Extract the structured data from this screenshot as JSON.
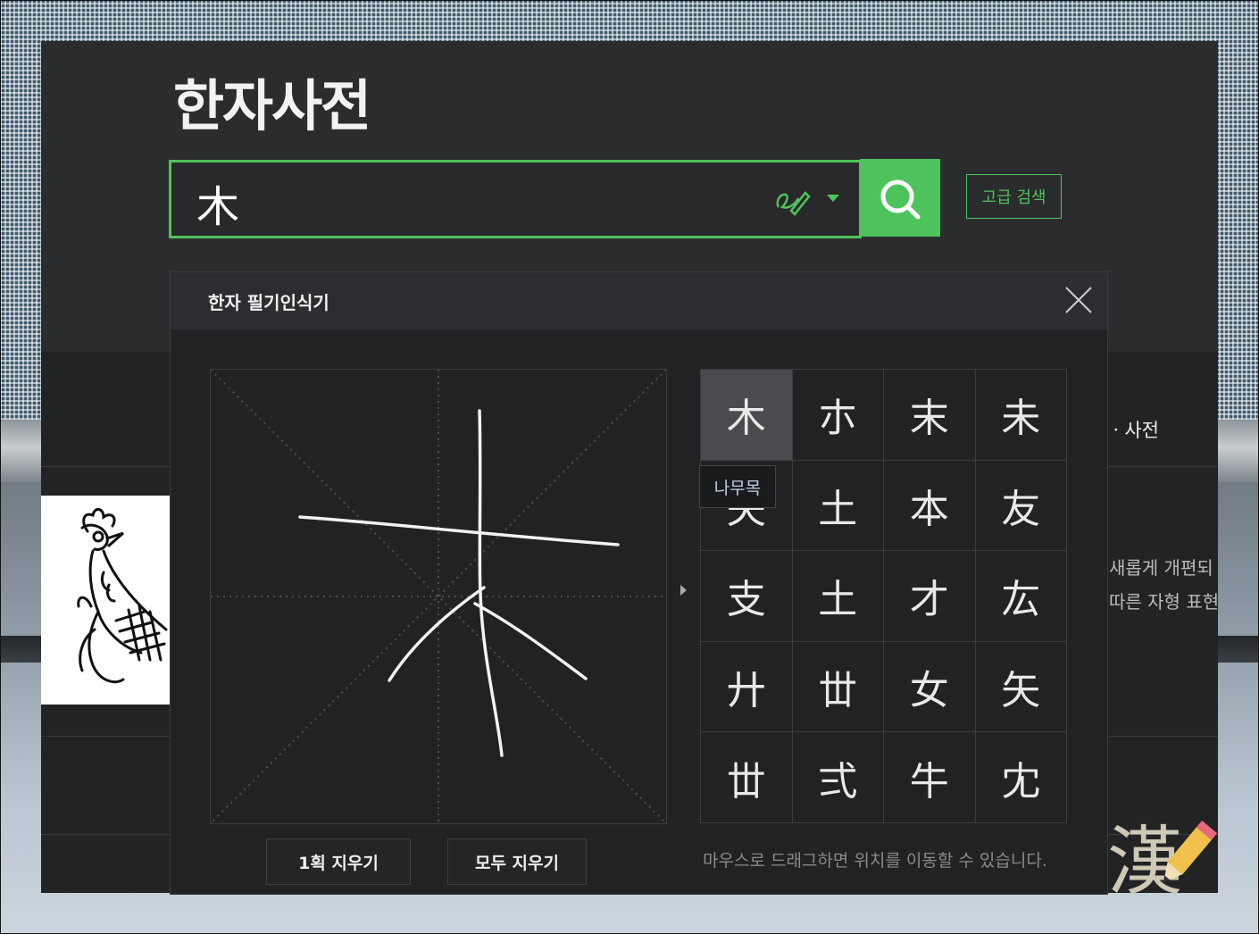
{
  "page": {
    "title": "한자사전",
    "search": {
      "value": "木",
      "advanced_label": "고급 검색"
    },
    "side_label": "ㆍ사전",
    "side_text_1": "새롭게 개편되",
    "side_text_2": "따른 자형 표현",
    "deco_hanja": "漢"
  },
  "popup": {
    "title": "한자 필기인식기",
    "undo_label": "1획 지우기",
    "clear_label": "모두 지우기",
    "hint": "마우스로 드래그하면 위치를 이동할 수 있습니다.",
    "tooltip": "나무목",
    "candidates": [
      "木",
      "朩",
      "末",
      "未",
      "夬",
      "土",
      "本",
      "友",
      "支",
      "土",
      "才",
      "厷",
      "廾",
      "丗",
      "女",
      "矢",
      "丗",
      "弍",
      "牛",
      "冘"
    ]
  },
  "colors": {
    "accent": "#4fc35b",
    "panel": "#212224",
    "header": "#2b2c2e"
  },
  "icons": {
    "search": "magnifier-icon",
    "pen": "pen-icon",
    "close": "close-icon",
    "dropdown": "chevron-down-icon"
  }
}
